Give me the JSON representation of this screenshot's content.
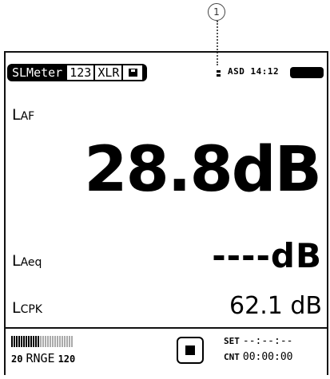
{
  "callout": {
    "number": "1"
  },
  "status_bar": {
    "app_tab": "SLMeter",
    "tabs": [
      "123",
      "XLR"
    ],
    "status_text": "ASD 14:12"
  },
  "measurements": {
    "laf": {
      "label_main": "L",
      "label_sub": "AF",
      "value": "28.8dB"
    },
    "laeq": {
      "label_main": "L",
      "label_sub": "Aeq",
      "value": "----dB"
    },
    "lcpk": {
      "label_main": "L",
      "label_sub": "CPK",
      "value": "62.1 dB"
    }
  },
  "footer": {
    "range_low": "20",
    "range_label": "RNGE",
    "range_high": "120",
    "set_label": "SET",
    "set_value": "--:--:--",
    "cnt_label": "CNT",
    "cnt_value": "00:00:00"
  }
}
